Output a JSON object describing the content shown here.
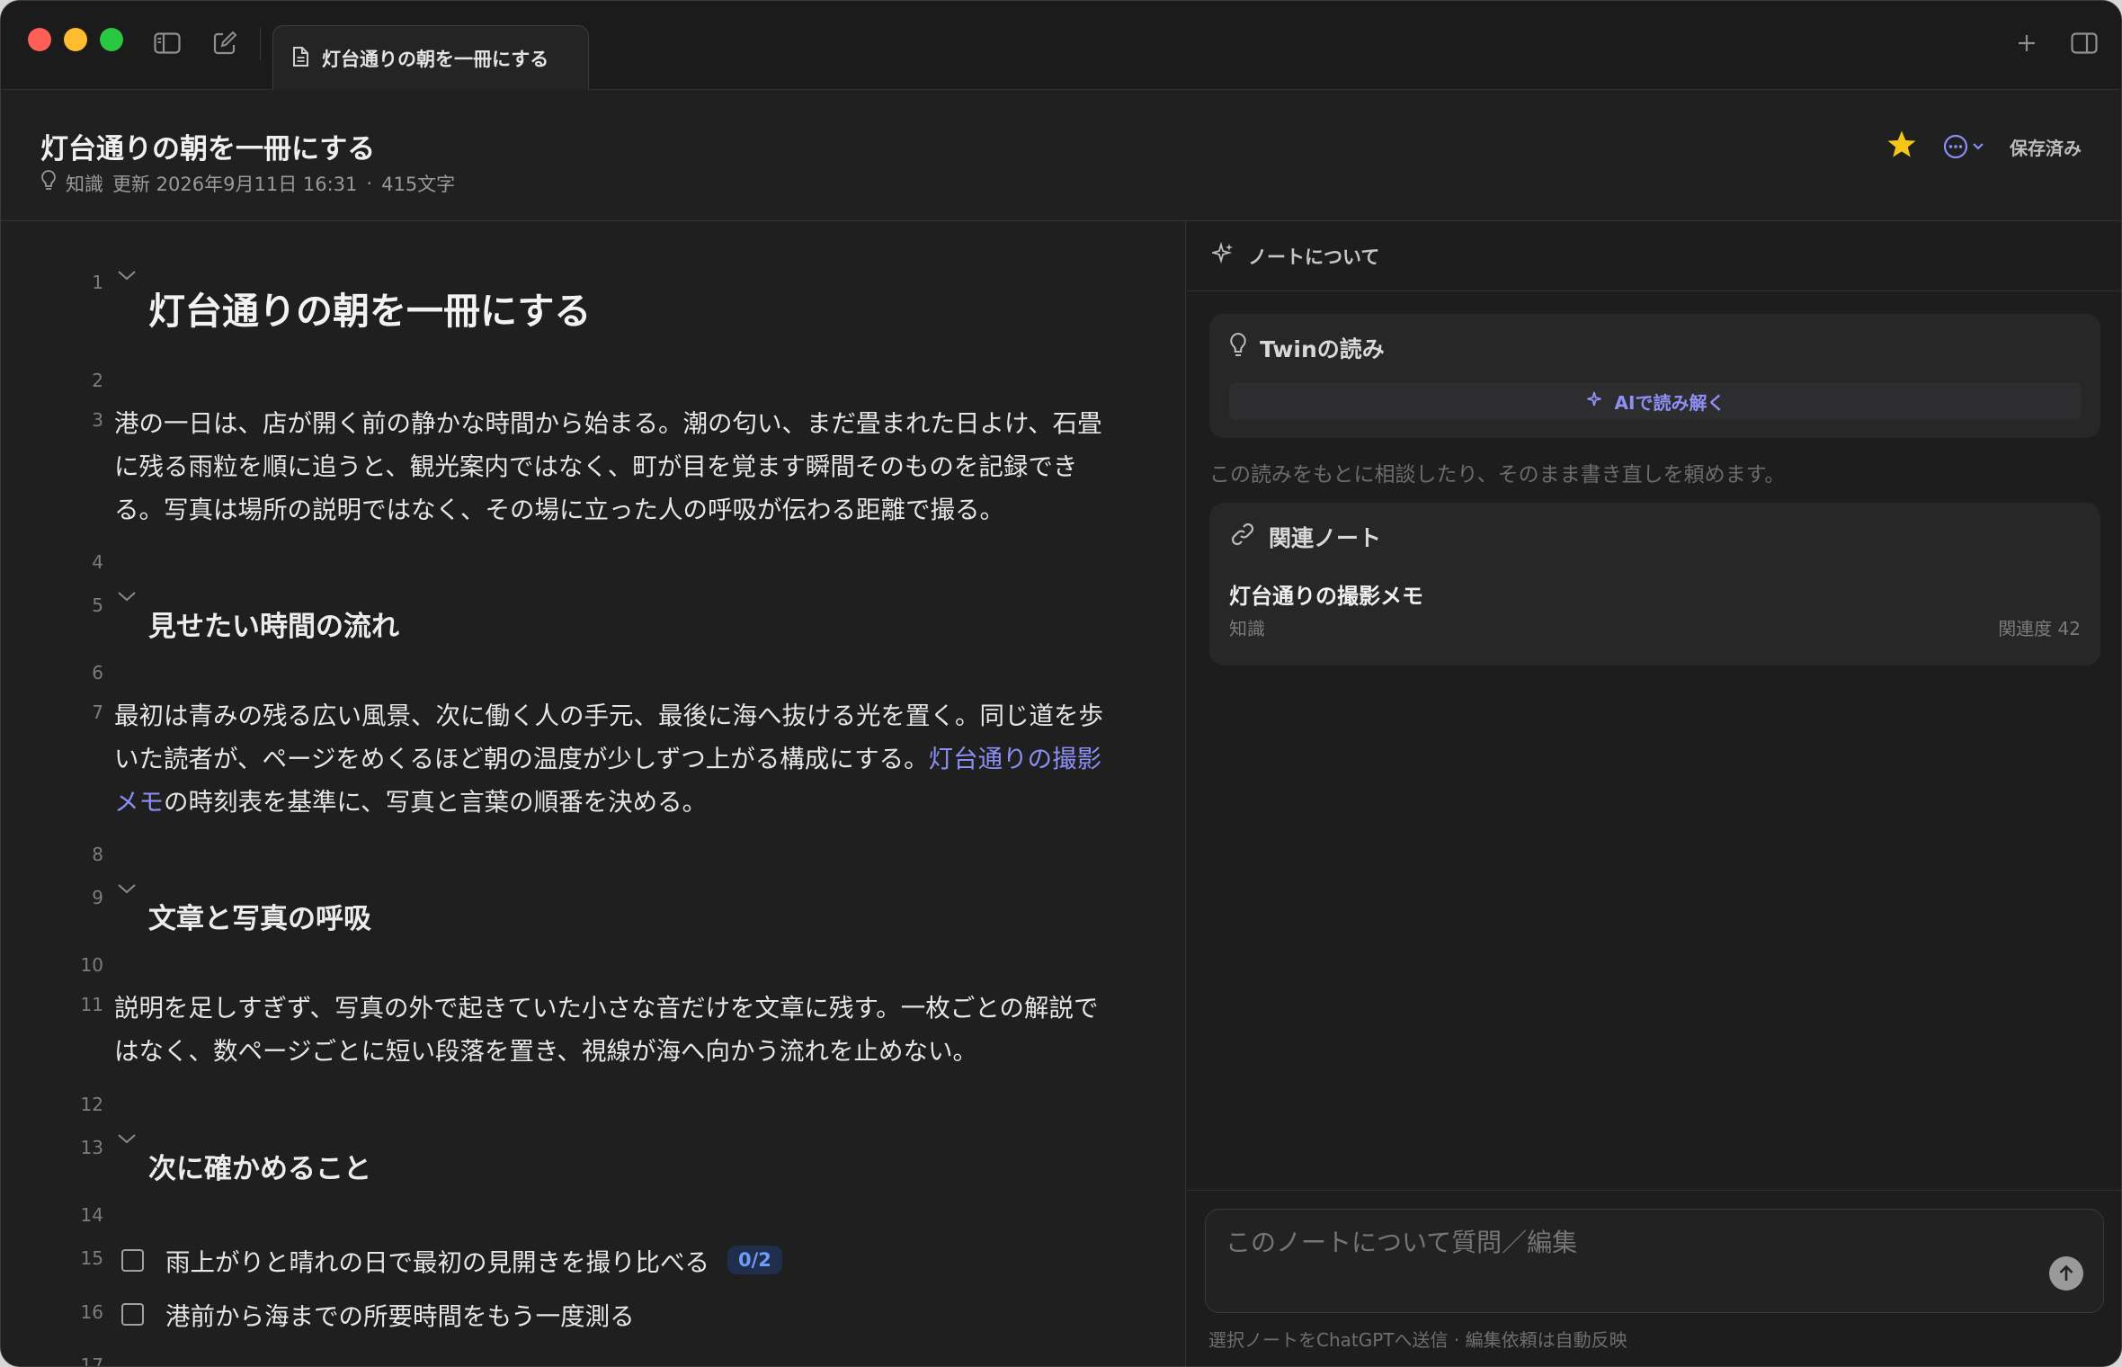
{
  "tab": {
    "label": "灯台通りの朝を一冊にする"
  },
  "header": {
    "title": "灯台通りの朝を一冊にする",
    "category": "知識",
    "updated": "更新 2026年9月11日 16:31",
    "separator": "·",
    "char_count": "415文字",
    "saved": "保存済み"
  },
  "editor": {
    "line_numbers": [
      "1",
      "2",
      "3",
      "4",
      "5",
      "6",
      "7",
      "8",
      "9",
      "10",
      "11",
      "12",
      "13",
      "14",
      "15",
      "16",
      "17"
    ],
    "h1": "灯台通りの朝を一冊にする",
    "para1": [
      "港の一日は、店が開く前の静かな時間から始まる。潮の匂い、まだ畳まれた日よけ、石畳",
      "に残る雨粒を順に追うと、観光案内ではなく、町が目を覚ます瞬間そのものを記録でき",
      "る。写真は場所の説明ではなく、その場に立った人の呼吸が伝わる距離で撮る。"
    ],
    "h2_flow": "見せたい時間の流れ",
    "para2_l1": "最初は青みの残る広い風景、次に働く人の手元、最後に海へ抜ける光を置く。同じ道を歩",
    "para2_l2_a": "いた読者が、ページをめくるほど朝の温度が少しずつ上がる構成にする。",
    "para2_link_a": "灯台通りの撮影",
    "para2_link_b": "メモ",
    "para2_l3": "の時刻表を基準に、写真と言葉の順番を決める。",
    "h2_breath": "文章と写真の呼吸",
    "para3": [
      "説明を足しすぎず、写真の外で起きていた小さな音だけを文章に残す。一枚ごとの解説で",
      "はなく、数ページごとに短い段落を置き、視線が海へ向かう流れを止めない。"
    ],
    "h2_next": "次に確かめること",
    "task1": "雨上がりと晴れの日で最初の見開きを撮り比べる",
    "task1_badge": "0/2",
    "task2": "港前から海までの所要時間をもう一度測る"
  },
  "panel": {
    "head": "ノートについて",
    "twin_title": "Twinの読み",
    "ai_button": "AIで読み解く",
    "hint": "この読みをもとに相談したり、そのまま書き直しを頼めます。",
    "related_title": "関連ノート",
    "related_note": "灯台通りの撮影メモ",
    "related_category": "知識",
    "related_score": "関連度 42",
    "composer_placeholder": "このノートについて質問／編集",
    "footer": "選択ノートをChatGPTへ送信 · 編集依頼は自動反映"
  },
  "icons": {
    "sidebar": "sidebar-toggle-icon",
    "compose": "compose-icon",
    "doc": "document-icon",
    "plus": "plus-icon",
    "split": "split-view-icon",
    "bulb": "lightbulb-icon",
    "star": "star-icon",
    "more": "more-icon",
    "sparkle": "sparkle-icon",
    "link": "link-icon",
    "send": "send-arrow-icon"
  },
  "colors": {
    "accent": "#8b8ff5",
    "star": "#f5c518",
    "badge_text": "#6f9cf7"
  }
}
